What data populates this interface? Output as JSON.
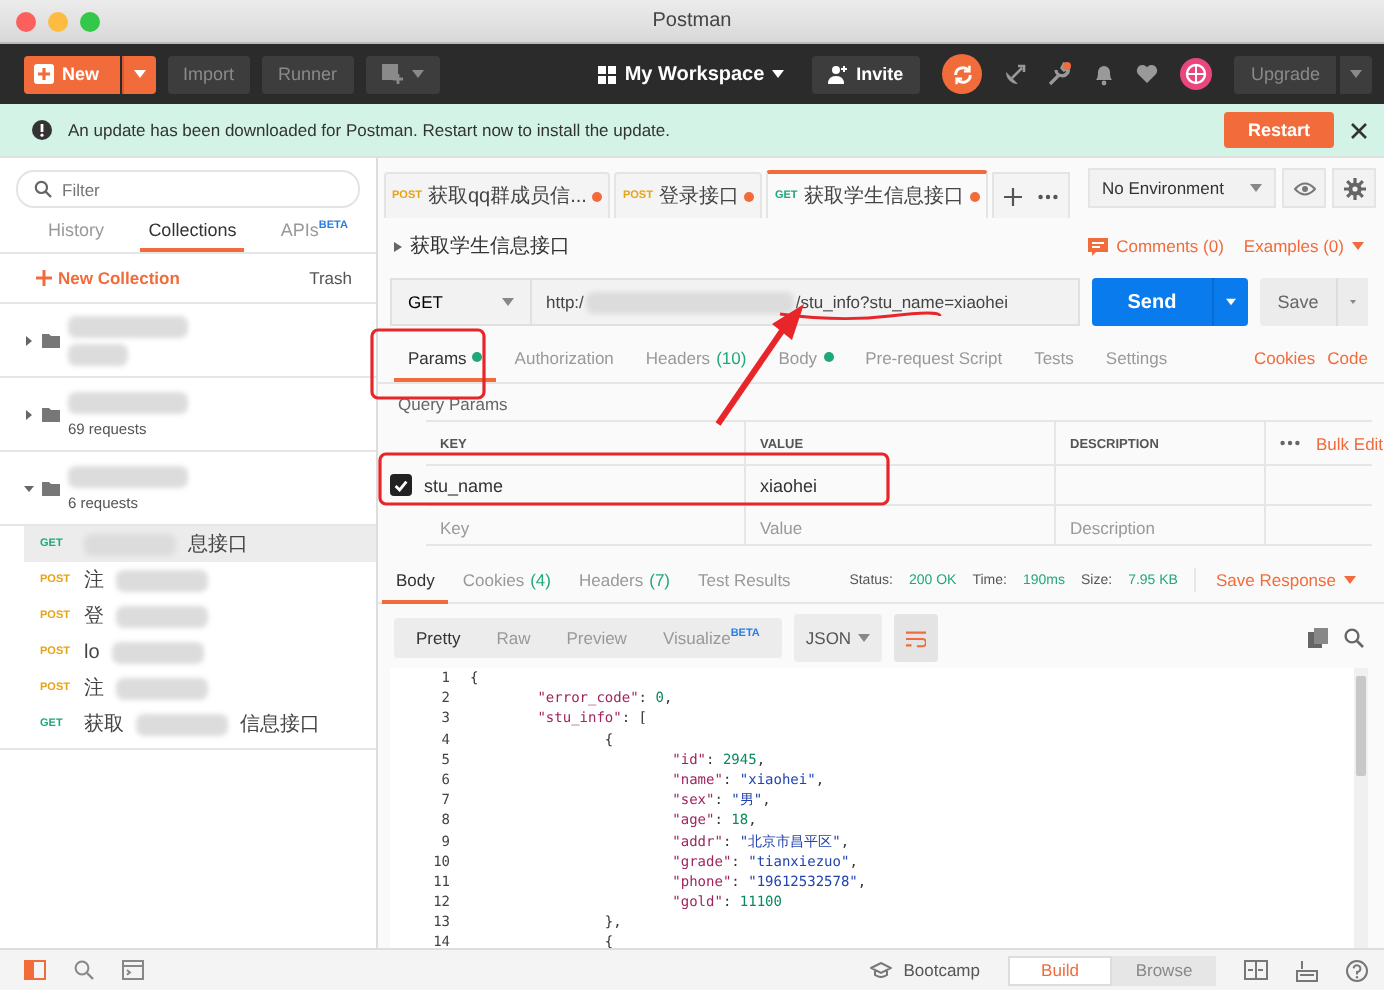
{
  "window": {
    "title": "Postman"
  },
  "toolbar": {
    "new_button": "New",
    "import_button": "Import",
    "runner_button": "Runner",
    "workspace": "My Workspace",
    "invite_button": "Invite",
    "upgrade_button": "Upgrade"
  },
  "banner": {
    "message": "An update has been downloaded for Postman. Restart now to install the update.",
    "restart_button": "Restart"
  },
  "sidebar": {
    "filter": {
      "placeholder": "Filter"
    },
    "tabs": [
      {
        "label": "History",
        "selected": false
      },
      {
        "label": "Collections",
        "selected": true
      },
      {
        "label": "APIs",
        "badge": "BETA",
        "selected": false
      }
    ],
    "new_collection": "New Collection",
    "trash": "Trash",
    "collections": [
      {
        "expanded": false
      },
      {
        "expanded": false,
        "count": "69 requests"
      },
      {
        "expanded": true,
        "count": "6 requests",
        "requests": [
          {
            "method": "GET",
            "selected": true,
            "name": [
              {
                "kind": "blur"
              },
              {
                "kind": "text",
                "text": "息接口"
              }
            ]
          },
          {
            "method": "POST",
            "selected": false,
            "name": [
              {
                "kind": "text",
                "text": "注"
              },
              {
                "kind": "blur"
              }
            ]
          },
          {
            "method": "POST",
            "selected": false,
            "name": [
              {
                "kind": "text",
                "text": "登"
              },
              {
                "kind": "blur"
              }
            ]
          },
          {
            "method": "POST",
            "selected": false,
            "name": [
              {
                "kind": "text",
                "text": "lo"
              },
              {
                "kind": "blur"
              }
            ]
          },
          {
            "method": "POST",
            "selected": false,
            "name": [
              {
                "kind": "text",
                "text": "注"
              },
              {
                "kind": "blur"
              }
            ]
          },
          {
            "method": "GET",
            "selected": false,
            "name": [
              {
                "kind": "text",
                "text": "获取"
              },
              {
                "kind": "blur"
              },
              {
                "kind": "text",
                "text": "信息接口"
              }
            ]
          }
        ]
      }
    ]
  },
  "request_tabs": [
    {
      "method": "POST",
      "name": "获取qq群成员信...",
      "unsaved": true,
      "selected": false
    },
    {
      "method": "POST",
      "name": "登录接口",
      "unsaved": true,
      "selected": false
    },
    {
      "method": "GET",
      "name": "获取学生信息接口",
      "unsaved": true,
      "selected": true
    }
  ],
  "environment": "No Environment",
  "request": {
    "title": "获取学生信息接口",
    "comments": "Comments (0)",
    "examples": "Examples (0)",
    "method": "GET",
    "url": [
      {
        "kind": "text",
        "text": "http:/"
      },
      {
        "kind": "blur"
      },
      {
        "kind": "text",
        "text": "/stu_info?stu_name=xiaohei"
      }
    ],
    "send_button": "Send",
    "save_button": "Save"
  },
  "request_options": {
    "tabs": [
      {
        "label": "Params",
        "dot": true,
        "selected": true
      },
      {
        "label": "Authorization",
        "dot": false,
        "selected": false
      },
      {
        "label": "Headers",
        "count": "(10)",
        "dot": false,
        "selected": false
      },
      {
        "label": "Body",
        "dot": true,
        "selected": false
      },
      {
        "label": "Pre-request Script",
        "dot": false,
        "selected": false
      },
      {
        "label": "Tests",
        "dot": false,
        "selected": false
      },
      {
        "label": "Settings",
        "dot": false,
        "selected": false
      }
    ],
    "links": [
      "Cookies",
      "Code"
    ]
  },
  "query_params": {
    "label": "Query Params",
    "columns": [
      "KEY",
      "VALUE",
      "DESCRIPTION"
    ],
    "bulk_edit": "Bulk Edit",
    "rows": [
      {
        "checked": true,
        "key": "stu_name",
        "value": "xiaohei"
      }
    ],
    "new_row": {
      "key_placeholder": "Key",
      "value_placeholder": "Value",
      "description_placeholder": "Description"
    }
  },
  "response": {
    "tabs": [
      {
        "label": "Body",
        "selected": true
      },
      {
        "label": "Cookies",
        "count": "(4)",
        "selected": false
      },
      {
        "label": "Headers",
        "count": "(7)",
        "selected": false
      },
      {
        "label": "Test Results",
        "selected": false
      }
    ],
    "status_label": "Status:",
    "status": "200 OK",
    "time_label": "Time:",
    "time": "190ms",
    "size_label": "Size:",
    "size": "7.95 KB",
    "save_response": "Save Response",
    "views": [
      {
        "label": "Pretty",
        "selected": true
      },
      {
        "label": "Raw",
        "selected": false
      },
      {
        "label": "Preview",
        "selected": false
      },
      {
        "label": "Visualize",
        "badge": "BETA",
        "selected": false
      }
    ],
    "format": "JSON",
    "code_lines": [
      {
        "num": "1",
        "text": "{"
      },
      {
        "num": "2",
        "text": "        \"error_code\": 0,"
      },
      {
        "num": "3",
        "text": "        \"stu_info\": ["
      },
      {
        "num": "4",
        "text": "                {"
      },
      {
        "num": "5",
        "text": "                        \"id\": 2945,"
      },
      {
        "num": "6",
        "text": "                        \"name\": \"xiaohei\","
      },
      {
        "num": "7",
        "text": "                        \"sex\": \"男\","
      },
      {
        "num": "8",
        "text": "                        \"age\": 18,"
      },
      {
        "num": "9",
        "text": "                        \"addr\": \"北京市昌平区\","
      },
      {
        "num": "10",
        "text": "                        \"grade\": \"tianxiezuo\","
      },
      {
        "num": "11",
        "text": "                        \"phone\": \"19612532578\","
      },
      {
        "num": "12",
        "text": "                        \"gold\": 11100"
      },
      {
        "num": "13",
        "text": "                },"
      },
      {
        "num": "14",
        "text": "                {"
      }
    ]
  },
  "status_bar": {
    "bootcamp": "Bootcamp",
    "tabs": [
      {
        "label": "Build",
        "selected": true
      },
      {
        "label": "Browse",
        "selected": false
      }
    ]
  }
}
